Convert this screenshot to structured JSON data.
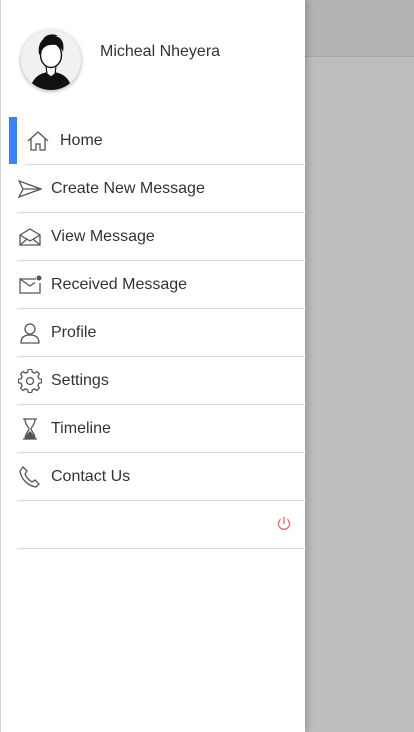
{
  "drawer": {
    "user": {
      "name": "Micheal Nheyera",
      "avatar_icon": "user-avatar-icon"
    },
    "accent_color": "#3b82f6",
    "menu": [
      {
        "label": "Home",
        "icon": "home-icon",
        "active": true
      },
      {
        "label": "Create New Message",
        "icon": "send-icon",
        "active": false
      },
      {
        "label": "View Message",
        "icon": "open-envelope-icon",
        "active": false
      },
      {
        "label": "Received Message",
        "icon": "mail-notification-icon",
        "active": false
      },
      {
        "label": "Profile",
        "icon": "user-icon",
        "active": false
      },
      {
        "label": "Settings",
        "icon": "gear-icon",
        "active": false
      },
      {
        "label": "Timeline",
        "icon": "hourglass-icon",
        "active": false
      },
      {
        "label": "Contact Us",
        "icon": "phone-icon",
        "active": false
      }
    ],
    "logout": {
      "icon": "power-icon",
      "color": "#e57373"
    }
  }
}
